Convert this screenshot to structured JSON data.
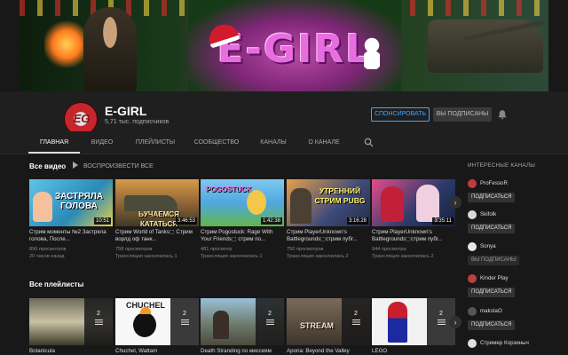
{
  "channel": {
    "name": "E-GIRL",
    "subscribers": "5,71 тыс. подписчиков",
    "avatar_text": "EG",
    "banner_text": "E-GIRL",
    "sponsor_label": "СПОНСИРОВАТЬ",
    "subscribed_label": "ВЫ ПОДПИСАНЫ"
  },
  "tabs": [
    {
      "label": "ГЛАВНАЯ",
      "active": true
    },
    {
      "label": "ВИДЕО"
    },
    {
      "label": "ПЛЕЙЛИСТЫ"
    },
    {
      "label": "СООБЩЕСТВО"
    },
    {
      "label": "КАНАЛЫ"
    },
    {
      "label": "О КАНАЛЕ"
    }
  ],
  "videos_section": {
    "title": "Все видео",
    "play_all": "ВОСПРОИЗВЕСТИ ВСЕ",
    "items": [
      {
        "title": "Стрим моменты №2 Застряла голова, После...",
        "views": "896 просмотров",
        "age": "20 часов назад",
        "duration": "10:51",
        "thumb_text": "ЗАСТРЯЛА ГОЛОВА"
      },
      {
        "title": "Стрим World of Tanks⬚ Стрим ворлд оф танк...",
        "views": "758 просмотров",
        "age": "Трансляция закончилась 1",
        "duration": "3:46:53",
        "thumb_text": "ЬУЧАЕМСЯ КАТАТЬСЯ"
      },
      {
        "title": "Стрим Pogostuck: Rage With Your Friends⬚ стрим по...",
        "views": "481 просмотр",
        "age": "Трансляция закончилась 1",
        "duration": "1:42:38",
        "thumb_text": "POGOSTUCK"
      },
      {
        "title": "Стрим PlayerUnknown's Battlegrounds⬚стрим пубг...",
        "views": "750 просмотров",
        "age": "Трансляция закончилась 2",
        "duration": "3:16:28",
        "thumb_text": "УТРЕННИЙ СТРИМ PUBG"
      },
      {
        "title": "Стрим PlayerUnknown's Battlegrounds⬚стрим пубг...",
        "views": "944 просмотра",
        "age": "Трансляция закончилась 2",
        "duration": "3:35:11",
        "thumb_text": ""
      }
    ]
  },
  "playlists_section": {
    "title": "Все плейлисты",
    "items": [
      {
        "title": "Botanicula",
        "count": "2"
      },
      {
        "title": "Chuchel, Wattam",
        "count": "2",
        "thumb_text": "CHUCHEL"
      },
      {
        "title": "Death Stranding по миссиям",
        "count": "2"
      },
      {
        "title": "Aporia: Beyond the Valley",
        "count": "2",
        "thumb_text": "STREAM"
      },
      {
        "title": "LEGO",
        "count": "2"
      }
    ]
  },
  "sidebar": {
    "title": "ИНТЕРЕСНЫЕ КАНАЛЫ",
    "channels": [
      {
        "name": "ProFessoR",
        "button": "ПОДПИСАТЬСЯ",
        "subscribed": false,
        "color": "#c23b3b"
      },
      {
        "name": "Skifolk",
        "button": "ПОДПИСАТЬСЯ",
        "subscribed": false,
        "color": "#d9d9d9"
      },
      {
        "name": "Sonya",
        "button": "ВЫ ПОДПИСАНЫ",
        "subscribed": true,
        "color": "#e7e7e7"
      },
      {
        "name": "Kinder Play",
        "button": "ПОДПИСАТЬСЯ",
        "subscribed": false,
        "color": "#b7423c"
      },
      {
        "name": "makstaO",
        "button": "ПОДПИСАТЬСЯ",
        "subscribed": false,
        "color": "#555"
      },
      {
        "name": "Стример Корзиныч",
        "button": "",
        "subscribed": false,
        "color": "#e0e0e0"
      }
    ]
  },
  "colors": {
    "background": "#181818",
    "header": "#1f1f1f",
    "accent": "#3ea6ff"
  }
}
